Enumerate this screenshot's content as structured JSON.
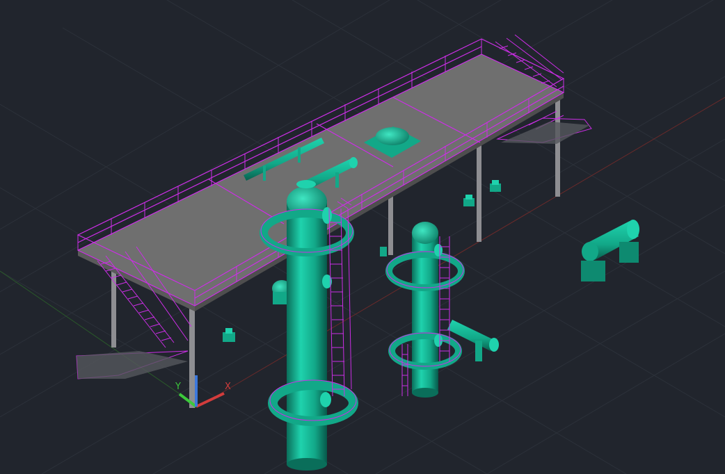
{
  "viewport": {
    "background": "#21252d",
    "grid_color": "#2c313a",
    "accent_teal": "#12a888",
    "accent_magenta": "#cc2ee6",
    "platform_fill": "#6f6f6f",
    "steel_color": "#8e8e92"
  },
  "ucs_icon": {
    "x_label": "X",
    "y_label": "Y",
    "x_color": "#d23c3c",
    "y_color": "#3cc83c",
    "z_color": "#3c78dc"
  }
}
